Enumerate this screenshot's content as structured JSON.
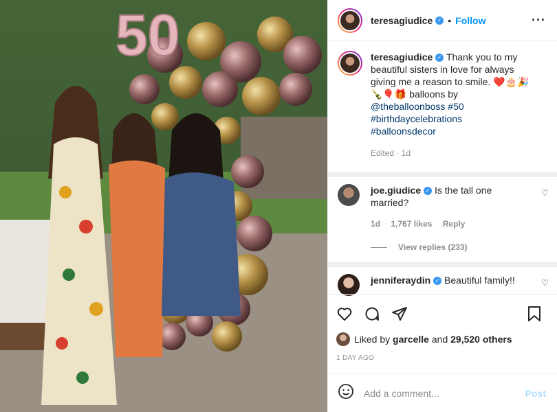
{
  "post": {
    "username": "teresagiudice",
    "follow_label": "Follow",
    "caption_lines": [
      "Thank you to my",
      "beautiful sisters in love for always",
      "giving me a reason to smile. ❤️🎂🎉",
      "🍾🎈🎁 balloons by"
    ],
    "mention": "@theballoonboss",
    "hashtag1": "#50",
    "hashtag2": "#birthdaycelebrations",
    "hashtag3": "#balloonsdecor",
    "edited": "Edited · 1d"
  },
  "comments": [
    {
      "username": "joe.giudice",
      "text_line1": "Is the tall one",
      "text_line2": "married?",
      "time": "1d",
      "likes": "1,767 likes",
      "reply": "Reply",
      "view_replies": "View replies (233)"
    },
    {
      "username": "jenniferaydin",
      "text": "Beautiful family!!"
    }
  ],
  "likes": {
    "prefix": "Liked by",
    "user": "garcelle",
    "middle": "and",
    "count": "29,520 others"
  },
  "time_ago": "1 DAY AGO",
  "add_comment": {
    "placeholder": "Add a comment...",
    "post_label": "Post"
  },
  "colors": {
    "accent": "#0095f6",
    "verified": "#3897f0"
  }
}
